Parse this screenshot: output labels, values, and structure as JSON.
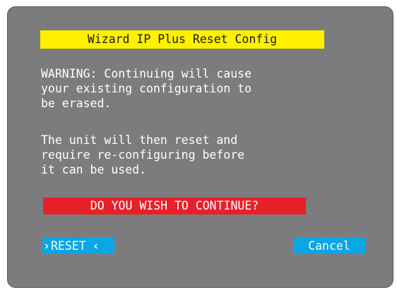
{
  "dialog": {
    "title": "Wizard IP Plus Reset Config",
    "warning_text": "WARNING: Continuing will cause\nyour existing configuration to\nbe erased.",
    "info_text": "The unit will then reset and\nrequire re-configuring before\nit can be used.",
    "prompt": "DO YOU WISH TO CONTINUE?",
    "buttons": {
      "reset": {
        "label": "RESET",
        "selected_marker_left": "›",
        "selected_marker_right": "‹"
      },
      "cancel": {
        "label": "Cancel"
      }
    },
    "colors": {
      "background": "#7c7c7f",
      "title_bar": "#fff000",
      "prompt_bar": "#e8202a",
      "button": "#0aa6e6",
      "text": "#ffffff"
    }
  }
}
